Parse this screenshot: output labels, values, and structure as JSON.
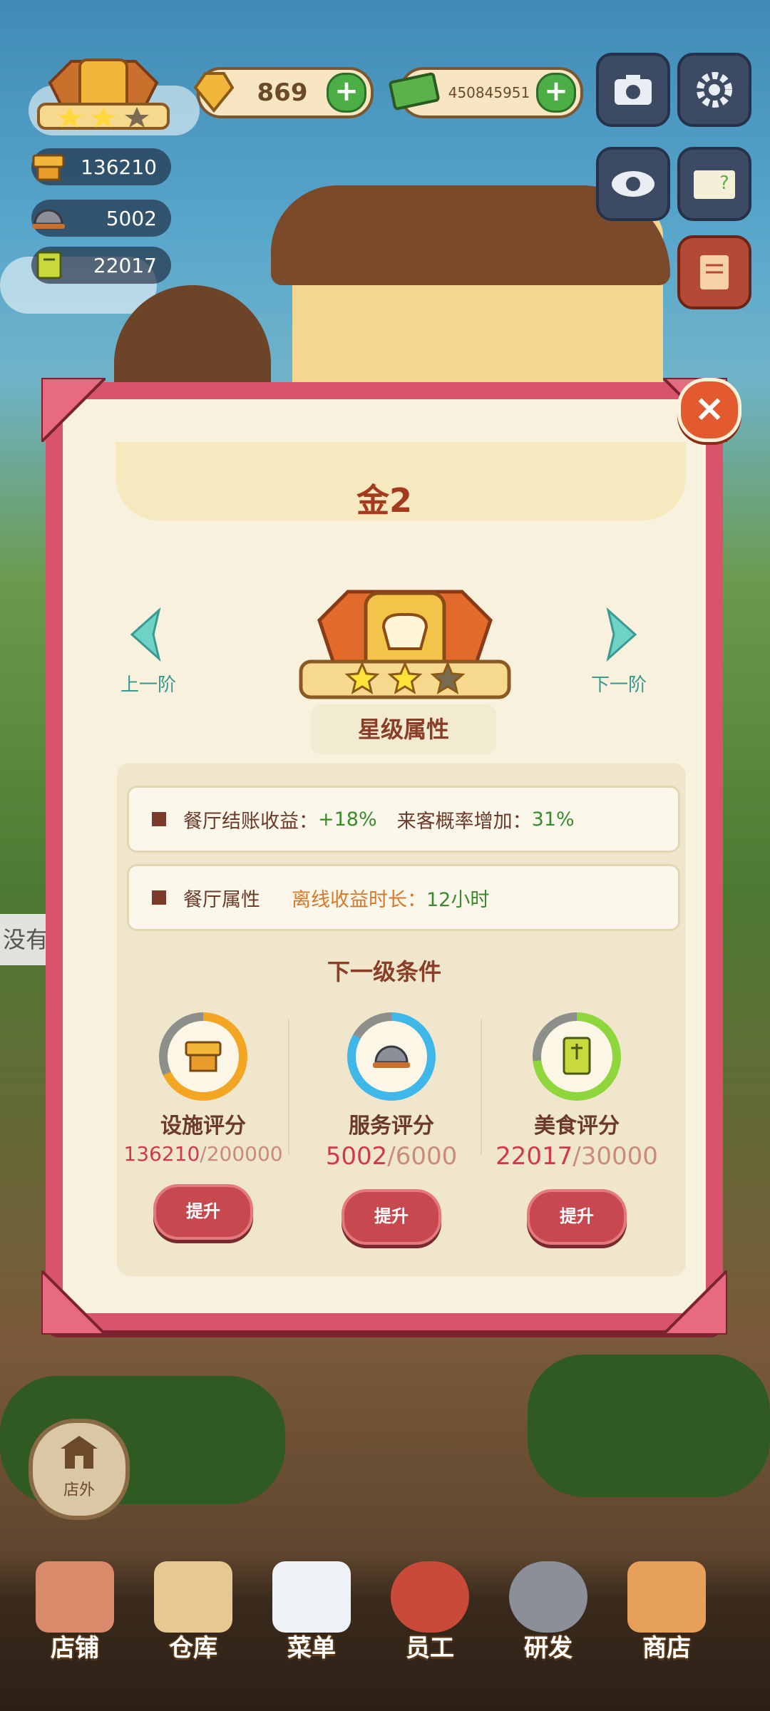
{
  "hud": {
    "facility_score": "136210",
    "service_score": "5002",
    "food_score": "22017",
    "gems": "869",
    "cash": "450845951"
  },
  "modal": {
    "title": "金2",
    "prev_label": "上一阶",
    "next_label": "下一阶",
    "section_title": "星级属性",
    "attr_row1": {
      "label": "餐厅结账收益：",
      "value": "+18%",
      "label2": "来客概率增加：",
      "value2": "31%"
    },
    "attr_row2": {
      "label": "餐厅属性",
      "label2": "离线收益时长：",
      "value2": "12小时"
    },
    "next_level_title": "下一级条件",
    "requirements": [
      {
        "name": "设施评分",
        "current": "136210",
        "max": "/200000",
        "button": "提升",
        "fraction": 0.681,
        "color": "#f2a623"
      },
      {
        "name": "服务评分",
        "current": "5002",
        "max": "/6000",
        "button": "提升",
        "fraction": 0.834,
        "color": "#3fb7e8"
      },
      {
        "name": "美食评分",
        "current": "22017",
        "max": "/30000",
        "button": "提升",
        "fraction": 0.734,
        "color": "#8fd63c"
      }
    ],
    "stars_filled": 2,
    "stars_total": 3
  },
  "side": {
    "partial_text": "没有",
    "outside_label": "店外"
  },
  "bottom_nav": [
    {
      "label": "店铺"
    },
    {
      "label": "仓库"
    },
    {
      "label": "菜单"
    },
    {
      "label": "员工"
    },
    {
      "label": "研发"
    },
    {
      "label": "商店"
    }
  ]
}
